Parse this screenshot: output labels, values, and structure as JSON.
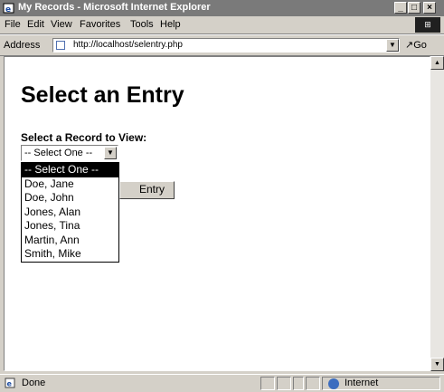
{
  "window": {
    "title": "My Records - Microsoft Internet Explorer",
    "minimize": "_",
    "restore": "□",
    "close": "×"
  },
  "menu": {
    "file": "File",
    "edit": "Edit",
    "view": "View",
    "favorites": "Favorites",
    "tools": "Tools",
    "help": "Help"
  },
  "address": {
    "label": "Address",
    "url": "http://localhost/selentry.php",
    "go": "Go"
  },
  "page": {
    "heading": "Select an Entry",
    "select_label": "Select a Record to View:",
    "select_value": "-- Select One --",
    "options": [
      "-- Select One --",
      "Doe, Jane",
      "Doe, John",
      "Jones, Alan",
      "Jones, Tina",
      "Martin, Ann",
      "Smith, Mike"
    ],
    "selected_index": 0,
    "button_label_visible": "Entry"
  },
  "status": {
    "text": "Done",
    "zone": "Internet"
  },
  "colors": {
    "titlebar": "#7a7a7a",
    "chrome": "#d4d0c8",
    "selected_option_bg": "#000000"
  }
}
